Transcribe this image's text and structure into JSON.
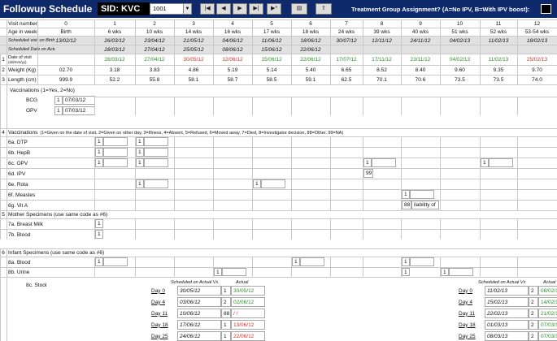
{
  "header": {
    "title": "Followup Schedule",
    "sid_label": "SID: KVC",
    "sid_value": "1001",
    "treatment_question": "Treatment Group Assignment? (A=No IPV, B=With IPV boost):"
  },
  "visits": {
    "row_label": "Visit number",
    "numbers": [
      "0",
      "1",
      "2",
      "3",
      "4",
      "5",
      "6",
      "7",
      "8",
      "9",
      "10",
      "11",
      "12"
    ],
    "age_label": "Age in weeks",
    "ages": [
      "Birth",
      "6 wks",
      "10 wks",
      "14 wks",
      "16 wks",
      "17 wks",
      "18 wks",
      "24 wks",
      "39 wks",
      "40 wks",
      "51 wks",
      "52 wks",
      "53-54 wks"
    ],
    "sched_birth_label": "Scheduled visit on Birth Date",
    "sched_birth": [
      "13/02/12",
      "26/03/12",
      "23/04/12",
      "21/05/12",
      "04/06/12",
      "11/06/12",
      "18/06/12",
      "30/07/12",
      "12/11/12",
      "24/11/12",
      "04/02/13",
      "11/02/13",
      "18/02/13"
    ],
    "sched_vx_label": "Scheduled Date on Actual Vx",
    "sched_vx": [
      "",
      "28/03/12",
      "27/04/12",
      "25/05/12",
      "08/06/12",
      "15/06/12",
      "22/06/12",
      "",
      "",
      "",
      "",
      "",
      ""
    ],
    "date_label": "Date of visit",
    "date_sub": "(dd/mm/yy)",
    "dates": [
      "",
      "28/03/12",
      "27/04/12",
      "30/05/12",
      "12/06/12",
      "15/06/12",
      "22/06/12",
      "17/07/12",
      "17/11/12",
      "23/11/12",
      "04/02/13",
      "11/02/13",
      "25/02/13"
    ],
    "date_colors": [
      "",
      "green",
      "green",
      "red",
      "red",
      "green",
      "green",
      "green",
      "green",
      "green",
      "green",
      "green",
      "red"
    ]
  },
  "measures": {
    "weight_label": "Weight (Kg)",
    "weights": [
      "02.70",
      "3.18",
      "3.83",
      "4.86",
      "5.19",
      "5.14",
      "5.40",
      "6.65",
      "8.52",
      "8.40",
      "9.60",
      "9.35",
      "9.70"
    ],
    "length_label": "Length (cm)",
    "lengths": [
      "999.9",
      "52.2",
      "55.8",
      "58.1",
      "58.7",
      "58.5",
      "59.1",
      "62.5",
      "70.1",
      "70.6",
      "73.5",
      "73.5",
      "74.0"
    ]
  },
  "rownums": [
    "1",
    "2",
    "3",
    "4",
    "5",
    "6",
    "7",
    "8"
  ],
  "vacc_birth": {
    "header": "Vaccinations (1=Yes, 2=No)",
    "bcg": "BCG",
    "bcg_code": "1",
    "bcg_date": "07/03/12",
    "opv": "OPV",
    "opv_code": "1",
    "opv_date": "07/03/12"
  },
  "vacc": {
    "header": "Vaccinations",
    "legend": "(1=Given on the date of visit, 2=Given on other day, 3=Illness, 4=Absent, 5=Refused, 6=Moved away, 7=Died, 8=Investigator decision, 88=Other, 99=NA)",
    "dtp": "6a. DTP",
    "hepb": "6b. HepB",
    "opv": "6c. OPV",
    "ipv": "6d. IPV",
    "rota": "6e. Rota",
    "measles": "6f. Measles",
    "vita": "6g. Vit A",
    "code1": "1",
    "code99": "99",
    "code88": "88",
    "vita_note": "ilability of"
  },
  "mother": {
    "header": "Mother Specimens (use same code as #6)",
    "milk": "7a. Breast Milk",
    "blood": "7b. Blood",
    "code": "1"
  },
  "infant": {
    "header": "Infant Specimens (use same code as #6)",
    "blood": "8a. Blood",
    "urine": "8b. Urine",
    "stool": "8c. Stool",
    "code": "1",
    "sched_hdr": "Scheduled on Actual Vx",
    "actual_hdr": "Actual",
    "days": [
      "Day 0",
      "Day 4",
      "Day 11",
      "Day 18",
      "Day 25"
    ],
    "left_sched": [
      "30/05/12",
      "03/06/12",
      "10/06/12",
      "17/06/12",
      "24/06/12"
    ],
    "left_codes": [
      "1",
      "2",
      "88",
      "1",
      "1"
    ],
    "left_actual": [
      "30/05/12",
      "02/06/12",
      "/ /",
      "13/06/12",
      "22/06/12"
    ],
    "left_colors": [
      "green",
      "green",
      "red",
      "red",
      "red"
    ],
    "right_sched": [
      "11/02/13",
      "15/02/13",
      "22/02/13",
      "01/03/13",
      "08/03/13"
    ],
    "right_codes": [
      "2",
      "2",
      "2",
      "2",
      "2"
    ],
    "right_actual": [
      "08/02/13",
      "14/02/13",
      "21/02/13",
      "07/03/13",
      "07/03/13"
    ],
    "right_colors": [
      "green",
      "green",
      "green",
      "green",
      "green"
    ]
  },
  "colors": {
    "header_bg": "#0f2a6b",
    "green": "#2a8f2a",
    "red": "#d4302a",
    "gray": "#e1e1e1"
  }
}
